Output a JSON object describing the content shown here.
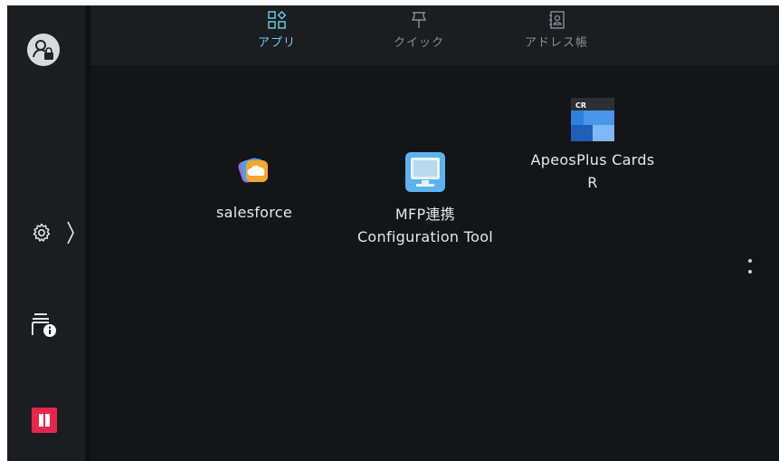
{
  "tabs": [
    {
      "label": "アプリ",
      "icon": "apps-grid-icon",
      "active": true
    },
    {
      "label": "クイック",
      "icon": "pin-icon",
      "active": false
    },
    {
      "label": "アドレス帳",
      "icon": "address-book-icon",
      "active": false
    }
  ],
  "sidebar": {
    "user_icon": "user-lock-icon",
    "settings_icon": "gear-icon",
    "device_info_icon": "device-info-icon",
    "pause_icon": "pause-icon"
  },
  "apps": [
    {
      "line1": "salesforce",
      "line2": "",
      "icon": "salesforce-icon"
    },
    {
      "line1": "MFP連携",
      "line2": "Configuration Tool",
      "icon": "monitor-icon"
    },
    {
      "line1": "ApeosPlus Cards",
      "line2": "R",
      "icon": "cards-r-icon",
      "icon_text": "CR"
    }
  ],
  "colors": {
    "accent": "#6bd0e8",
    "pause": "#e8264c",
    "background": "#15171a"
  }
}
